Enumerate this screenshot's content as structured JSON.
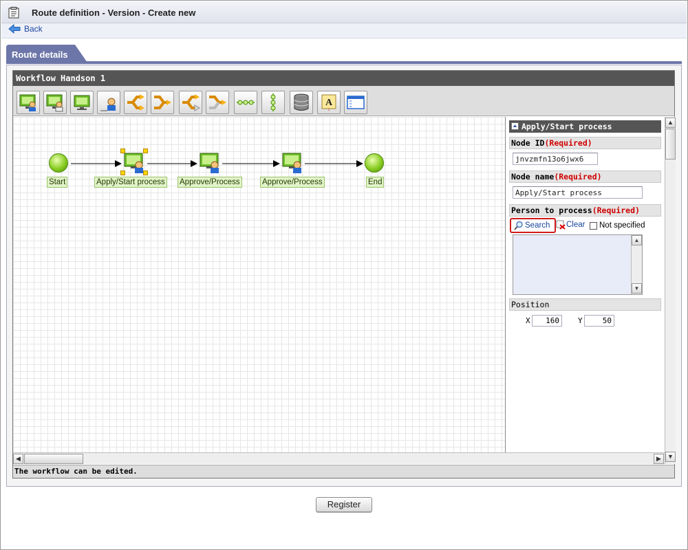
{
  "window": {
    "title": "Route definition - Version - Create new"
  },
  "nav": {
    "back_label": "Back"
  },
  "tabs": [
    {
      "label": "Route details"
    }
  ],
  "editor": {
    "workflow_name": "Workflow Handson 1",
    "status_text": "The workflow can be edited.",
    "toolbar_icons": [
      "apply-node-icon",
      "approve-node-icon",
      "monitor-node-icon",
      "user-node-icon",
      "branch-start-icon",
      "branch-end-icon",
      "branch-start-gray-icon",
      "branch-end-gray-icon",
      "horizontal-line-icon",
      "vertical-line-icon",
      "database-icon",
      "text-label-icon",
      "window-icon"
    ]
  },
  "diagram": {
    "nodes": [
      {
        "label": "Start",
        "kind": "start"
      },
      {
        "label": "Apply/Start process",
        "kind": "process",
        "selected": true
      },
      {
        "label": "Approve/Process",
        "kind": "process"
      },
      {
        "label": "Approve/Process",
        "kind": "process"
      },
      {
        "label": "End",
        "kind": "end"
      }
    ]
  },
  "properties": {
    "panel_title": "Apply/Start process",
    "node_id": {
      "label": "Node ID",
      "required": "(Required)",
      "value": "jnvzmfn13o6jwx6"
    },
    "node_name": {
      "label": "Node name",
      "required": "(Required)",
      "value": "Apply/Start process"
    },
    "person": {
      "label": "Person to process",
      "required": "(Required)",
      "search_label": "Search",
      "clear_label": "Clear",
      "not_specified_label": "Not specified"
    },
    "position": {
      "label": "Position",
      "x_label": "X",
      "x_value": "160",
      "y_label": "Y",
      "y_value": "50"
    }
  },
  "footer": {
    "register_label": "Register"
  },
  "colors": {
    "tab": "#6d76a8",
    "required": "#d00000",
    "link": "#1a46a0",
    "search_highlight": "#d21919"
  }
}
